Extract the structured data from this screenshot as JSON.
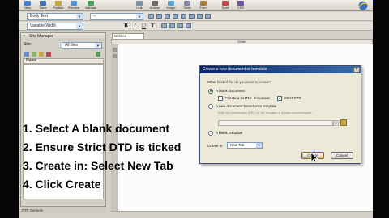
{
  "toolbar": {
    "buttons": [
      {
        "label": "New",
        "icon": "new-document-icon",
        "color": "#3f7ed6"
      },
      {
        "label": "Save",
        "icon": "save-icon",
        "color": "#4b6fae"
      },
      {
        "label": "Publish",
        "icon": "publish-icon",
        "color": "#c8a23a"
      },
      {
        "label": "Preview",
        "icon": "preview-icon",
        "color": "#5a8fd0"
      },
      {
        "label": "Validate",
        "icon": "validate-icon",
        "color": "#4aa05a"
      },
      {
        "label": "Link",
        "icon": "link-icon",
        "color": "#7b8fa8"
      },
      {
        "label": "Anchor",
        "icon": "anchor-icon",
        "color": "#6c6c6c"
      },
      {
        "label": "Image",
        "icon": "image-icon",
        "color": "#5aa0c8"
      },
      {
        "label": "Table",
        "icon": "table-icon",
        "color": "#8888aa"
      },
      {
        "label": "Form",
        "icon": "form-icon",
        "color": "#a57c3c"
      },
      {
        "label": "Spell",
        "icon": "spell-icon",
        "color": "#c04a4a"
      },
      {
        "label": "CSS",
        "icon": "css-icon",
        "color": "#7050a0"
      }
    ]
  },
  "format": {
    "paragraph": "Body Text",
    "font": "Variable Width",
    "size_placeholder": "--",
    "bold": "B",
    "italic": "I",
    "underline": "U",
    "typewriter": "T"
  },
  "site_manager": {
    "title": "Site Manager",
    "site_label": "Site:",
    "site_value": "All files",
    "column_header": "Name",
    "status": "FTP Console"
  },
  "editor": {
    "tab": "Untitled",
    "ruler_label": "Wider"
  },
  "dialog": {
    "title": "Create a new document or template",
    "close": "×",
    "question": "What kind of file do you want to create?",
    "option_blank": "A blank document",
    "option_xhtml": "Create a XHTML document",
    "option_strict": "Strict DTD",
    "option_template": "A new document based on a template",
    "template_hint": "Enter the path/location (URL) for the template or choose a local template.",
    "option_blank_template": "A blank template",
    "create_in_label": "Create in:",
    "create_in_value": "New Tab",
    "create_button": "Create",
    "cancel_button": "Cancel"
  },
  "instructions": {
    "step1": "1. Select A blank document",
    "step2": "2. Ensure Strict DTD is ticked",
    "step3": "3. Create in: Select New Tab",
    "step4": "4. Click Create"
  },
  "colors": {
    "dialog_title": "#0a246a",
    "accent": "#1a6b1a"
  }
}
